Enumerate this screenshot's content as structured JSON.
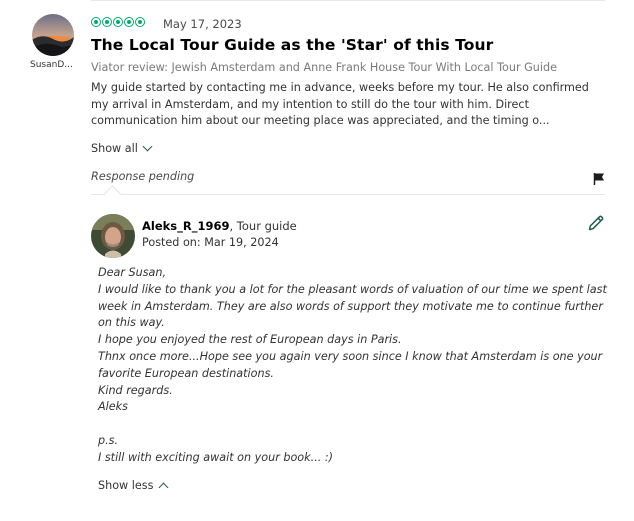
{
  "review": {
    "username": "SusanD...",
    "rating": 5,
    "date": "May 17, 2023",
    "title": "The Local Tour Guide as the 'Star' of this Tour",
    "source": "Viator review: Jewish Amsterdam and Anne Frank House Tour With Local Tour Guide",
    "body": "My guide started by contacting me in advance, weeks before my tour. He also confirmed my arrival in Amsterdam, and my intention to still do the tour with him. Direct communication him about our meeting place was appreciated, and the timing o...",
    "show_all_label": "Show all",
    "response_status": "Response pending"
  },
  "response": {
    "author": "Aleks_R_1969",
    "role": ", Tour guide",
    "posted": "Posted on: Mar 19, 2024",
    "lines": [
      "Dear Susan,",
      "I would like to thank you a lot for the pleasant words of valuation of our time we spent last week in Amsterdam. They are also words of support they motivate me to continue further on this way.",
      "I hope you enjoyed the rest of European days in Paris.",
      "Thnx once more...Hope see you again very soon since I know that Amsterdam is one your favorite European destinations.",
      "Kind regards.",
      "Aleks",
      "",
      "p.s.",
      "I still with exciting await on your book... :)"
    ],
    "show_less_label": "Show less"
  },
  "icons": {
    "flag": "flag-icon",
    "edit": "pencil-icon",
    "show_all": "chevron-down-icon",
    "show_less": "chevron-up-icon"
  },
  "colors": {
    "rating_green": "#00aa6c",
    "accent_dark_green": "#1f5d4c"
  }
}
